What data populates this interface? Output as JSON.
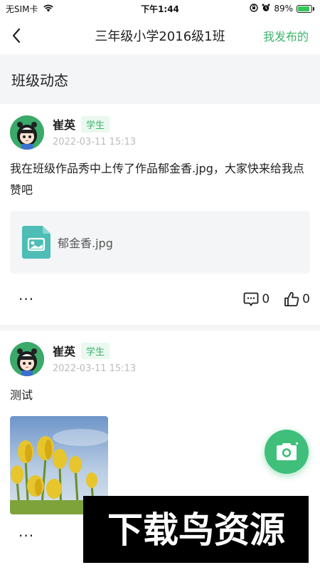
{
  "status_bar": {
    "carrier": "无SIM卡",
    "time": "下午1:44",
    "battery_pct": "89%",
    "battery_level": 0.89
  },
  "nav": {
    "title": "三年级小学2016级1班",
    "right_action": "我发布的"
  },
  "section": {
    "title": "班级动态"
  },
  "posts": [
    {
      "author": "崔英",
      "role": "学生",
      "time": "2022-03-11 15:13",
      "text": "我在班级作品秀中上传了作品郁金香.jpg，大家快来给我点赞吧",
      "attachment": "郁金香.jpg",
      "more": "···",
      "comments": "0",
      "likes": "0"
    },
    {
      "author": "崔英",
      "role": "学生",
      "time": "2022-03-11 15:13",
      "text": "测试",
      "more": "···"
    }
  ],
  "colors": {
    "accent": "#3db46d",
    "section_bg": "#f4f5f7",
    "fab": "#3fbf7a"
  },
  "watermark": "下载鸟资源"
}
